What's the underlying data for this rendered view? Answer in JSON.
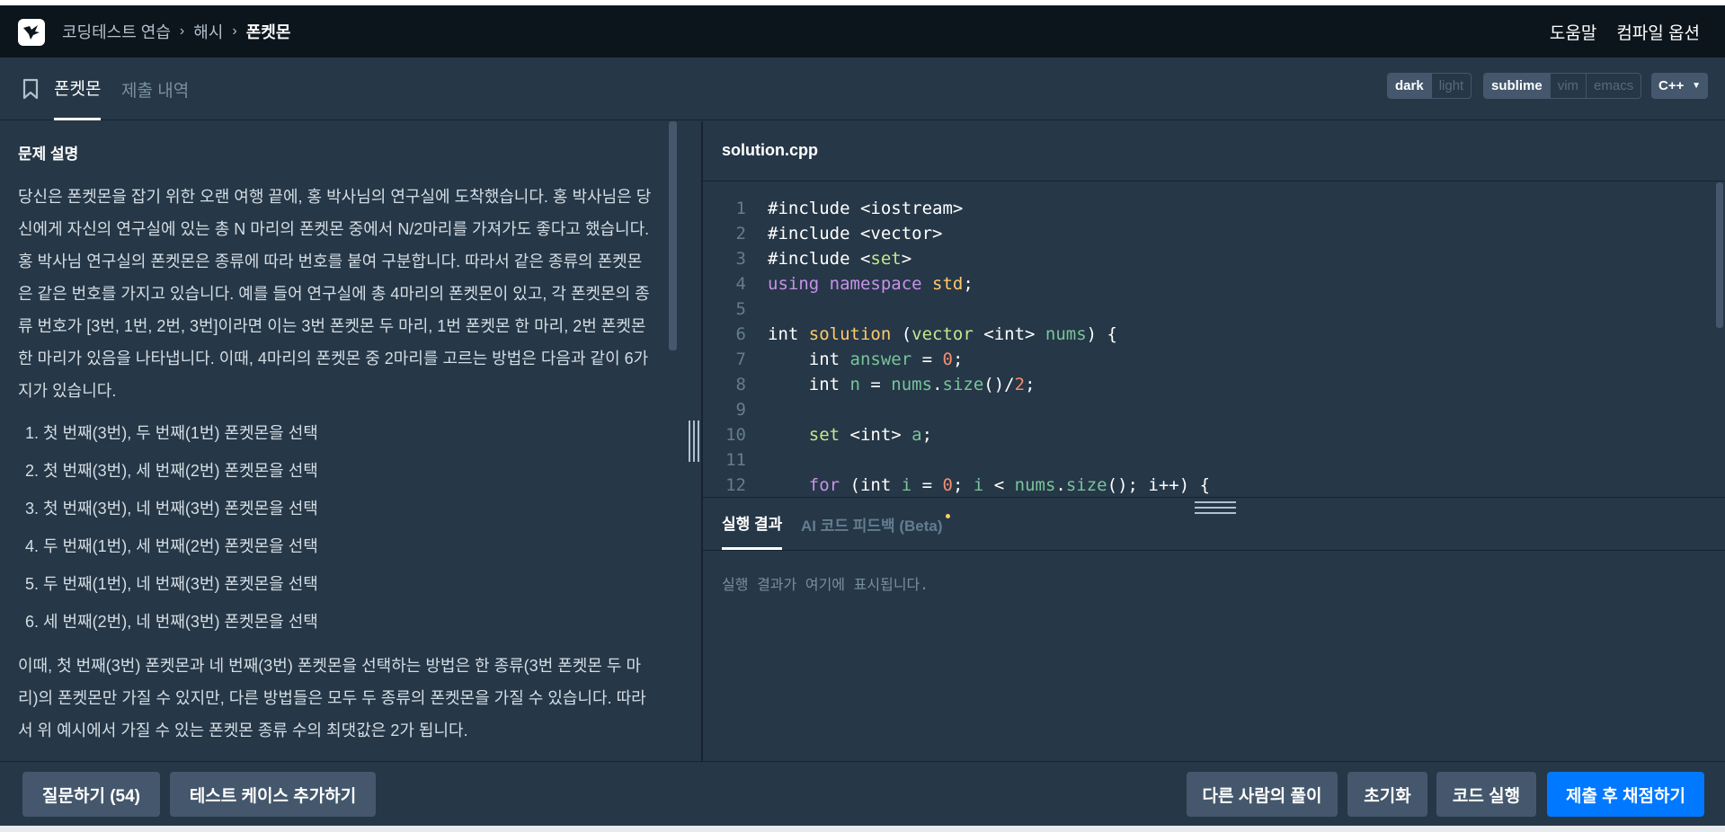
{
  "header": {
    "breadcrumb": [
      "코딩테스트 연습",
      "해시",
      "폰켓몬"
    ],
    "help": "도움말",
    "compile_options": "컴파일 옵션"
  },
  "subheader": {
    "tabs": [
      "폰켓몬",
      "제출 내역"
    ],
    "theme": [
      "dark",
      "light"
    ],
    "keymap": [
      "sublime",
      "vim",
      "emacs"
    ],
    "language": "C++"
  },
  "problem": {
    "title": "문제 설명",
    "p1": "당신은 폰켓몬을 잡기 위한 오랜 여행 끝에, 홍 박사님의 연구실에 도착했습니다. 홍 박사님은 당신에게 자신의 연구실에 있는 총 N 마리의 폰켓몬 중에서 N/2마리를 가져가도 좋다고 했습니다.",
    "p2": "홍 박사님 연구실의 폰켓몬은 종류에 따라 번호를 붙여 구분합니다. 따라서 같은 종류의 폰켓몬은 같은 번호를 가지고 있습니다. 예를 들어 연구실에 총 4마리의 폰켓몬이 있고, 각 폰켓몬의 종류 번호가 [3번, 1번, 2번, 3번]이라면 이는 3번 폰켓몬 두 마리, 1번 폰켓몬 한 마리, 2번 폰켓몬 한 마리가 있음을 나타냅니다. 이때, 4마리의 폰켓몬 중 2마리를 고르는 방법은 다음과 같이 6가지가 있습니다.",
    "options": [
      "첫 번째(3번), 두 번째(1번) 폰켓몬을 선택",
      "첫 번째(3번), 세 번째(2번) 폰켓몬을 선택",
      "첫 번째(3번), 네 번째(3번) 폰켓몬을 선택",
      "두 번째(1번), 세 번째(2번) 폰켓몬을 선택",
      "두 번째(1번), 네 번째(3번) 폰켓몬을 선택",
      "세 번째(2번), 네 번째(3번) 폰켓몬을 선택"
    ],
    "p3": "이때, 첫 번째(3번) 폰켓몬과 네 번째(3번) 폰켓몬을 선택하는 방법은 한 종류(3번 폰켓몬 두 마리)의 폰켓몬만 가질 수 있지만, 다른 방법들은 모두 두 종류의 폰켓몬을 가질 수 있습니다. 따라서 위 예시에서 가질 수 있는 폰켓몬 종류 수의 최댓값은 2가 됩니다."
  },
  "editor": {
    "file_name": "solution.cpp",
    "line_numbers": [
      "1",
      "2",
      "3",
      "4",
      "5",
      "6",
      "7",
      "8",
      "9",
      "10",
      "11",
      "12"
    ],
    "lines": [
      "#include <iostream>",
      "#include <vector>",
      "#include <set>",
      "using namespace std;",
      "",
      "int solution (vector <int> nums) {",
      "    int answer = 0;",
      "    int n = nums.size()/2;",
      "",
      "    set <int> a;",
      "",
      "    for (int i = 0; i < nums.size(); i++) {"
    ]
  },
  "result": {
    "tabs": [
      "실행 결과",
      "AI 코드 피드백 (Beta)"
    ],
    "placeholder": "실행 결과가 여기에 표시됩니다."
  },
  "footer": {
    "ask": "질문하기 (54)",
    "add_test": "테스트 케이스 추가하기",
    "others": "다른 사람의 풀이",
    "reset": "초기화",
    "run": "코드 실행",
    "submit": "제출 후 채점하기"
  }
}
